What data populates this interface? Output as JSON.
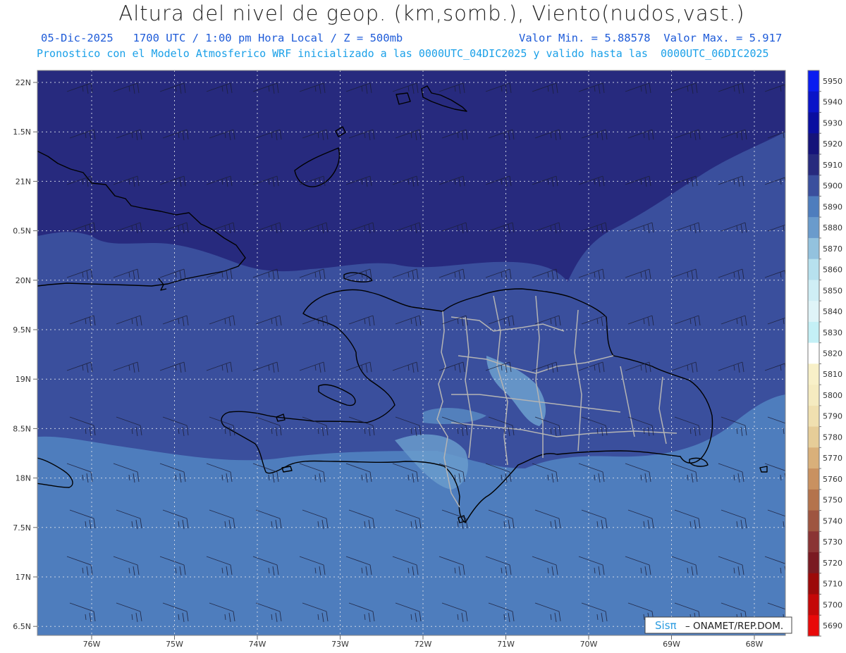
{
  "header": {
    "title": "Altura del nivel de geop. (km,somb.), Viento(nudos,vast.)",
    "line1_left": "05-Dic-2025   1700 UTC / 1:00 pm Hora Local / Z = 500mb",
    "line1_right": "Valor Min. = 5.88578  Valor Max. = 5.917",
    "line2": "Pronostico con el Modelo Atmosferico WRF inicializado a las 0000UTC_04DIC2025 y valido hasta las  0000UTC_06DIC2025"
  },
  "map": {
    "lat_labels": [
      "22N",
      "1.5N",
      "21N",
      "0.5N",
      "20N",
      "9.5N",
      "19N",
      "8.5N",
      "18N",
      "7.5N",
      "17N",
      "6.5N"
    ],
    "lon_labels": [
      "76W",
      "75W",
      "74W",
      "73W",
      "72W",
      "71W",
      "70W",
      "69W",
      "68W"
    ],
    "fill_colors": {
      "band_5910": "#272a7e",
      "band_5900": "#3a4f9d",
      "band_5890": "#4e7dbd",
      "band_5880": "#6a9bcc",
      "coast": "#000000",
      "provinces": "#b4b4b4"
    },
    "credit": {
      "brand": "Sisπ",
      "text": "– ONAMET/REP.DOM."
    }
  },
  "colorbar": {
    "levels": [
      "5950",
      "5940",
      "5930",
      "5920",
      "5910",
      "5900",
      "5890",
      "5880",
      "5870",
      "5860",
      "5850",
      "5840",
      "5830",
      "5820",
      "5810",
      "5800",
      "5790",
      "5780",
      "5770",
      "5760",
      "5750",
      "5740",
      "5730",
      "5720",
      "5710",
      "5700",
      "5690"
    ],
    "colors": [
      "#0a1cf0",
      "#0a14c8",
      "#0a0ea0",
      "#15137a",
      "#272a7e",
      "#3a4f9d",
      "#4e7dbd",
      "#6a9bcc",
      "#93c2de",
      "#b7e1ee",
      "#cfeef5",
      "#dff4f8",
      "#c4f0f6",
      "#ffffff",
      "#f8f0c8",
      "#f5ebc0",
      "#f0e0b0",
      "#e6cd98",
      "#d9b07a",
      "#c99160",
      "#b4734c",
      "#9e5540",
      "#8a3434",
      "#7a1a22",
      "#9c0a0a",
      "#c40808",
      "#e80a0a"
    ]
  }
}
